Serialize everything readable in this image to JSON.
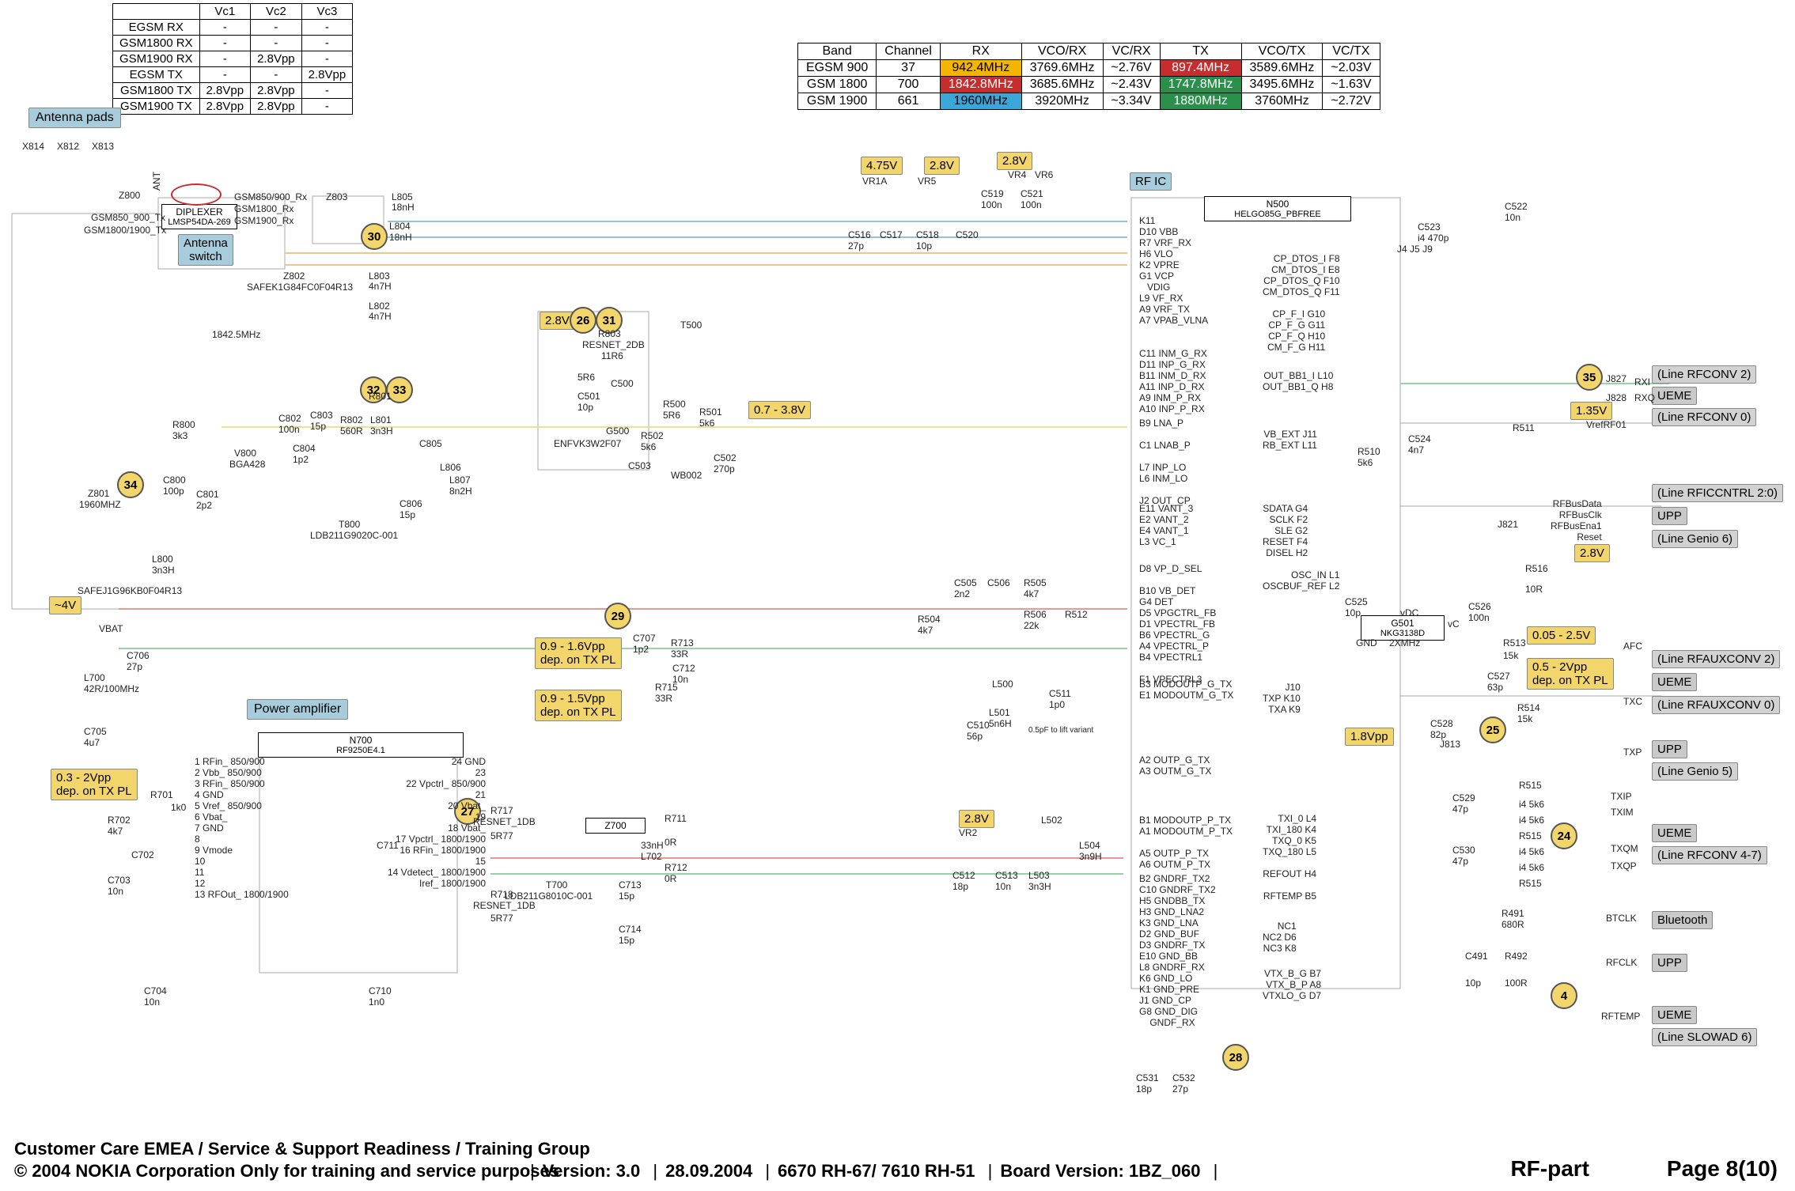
{
  "vc_table": {
    "headers": [
      "",
      "Vc1",
      "Vc2",
      "Vc3"
    ],
    "rows": [
      [
        "EGSM RX",
        "-",
        "-",
        "-"
      ],
      [
        "GSM1800 RX",
        "-",
        "-",
        "-"
      ],
      [
        "GSM1900 RX",
        "-",
        "2.8Vpp",
        "-"
      ],
      [
        "EGSM TX",
        "-",
        "-",
        "2.8Vpp"
      ],
      [
        "GSM1800 TX",
        "2.8Vpp",
        "2.8Vpp",
        "-"
      ],
      [
        "GSM1900 TX",
        "2.8Vpp",
        "2.8Vpp",
        "-"
      ]
    ]
  },
  "band_table": {
    "headers": [
      "Band",
      "Channel",
      "RX",
      "VCO/RX",
      "VC/RX",
      "TX",
      "VCO/TX",
      "VC/TX"
    ],
    "rows": [
      {
        "cells": [
          "EGSM 900",
          "37",
          "942.4MHz",
          "3769.6MHz",
          "~2.76V",
          "897.4MHz",
          "3589.6MHz",
          "~2.03V"
        ],
        "classes": [
          "",
          "",
          "c-yel",
          "",
          "",
          "c-red2",
          "",
          ""
        ]
      },
      {
        "cells": [
          "GSM 1800",
          "700",
          "1842.8MHz",
          "3685.6MHz",
          "~2.43V",
          "1747.8MHz",
          "3495.6MHz",
          "~1.63V"
        ],
        "classes": [
          "",
          "",
          "c-red2",
          "",
          "",
          "c-grn",
          "",
          ""
        ]
      },
      {
        "cells": [
          "GSM 1900",
          "661",
          "1960MHz",
          "3920MHz",
          "~3.34V",
          "1880MHz",
          "3760MHz",
          "~2.72V"
        ],
        "classes": [
          "",
          "",
          "c-blu",
          "",
          "",
          "c-grn",
          "",
          ""
        ]
      }
    ]
  },
  "tags": {
    "antenna_pads": "Antenna pads",
    "antenna_switch": "Antenna\nswitch",
    "power_amp": "Power amplifier",
    "rfic": "RF IC",
    "approx4v": "~4V",
    "v475": "4.75V",
    "v28a": "2.8V",
    "v28b": "2.8V",
    "v28c": "2.8V",
    "v28d": "2.8V",
    "v28e": "2.8V",
    "v135": "1.35V",
    "v18pp": "1.8Vpp",
    "v03_2": "0.3 - 2Vpp\ndep. on TX PL",
    "v09_16": "0.9 - 1.6Vpp\ndep. on TX PL",
    "v09_15": "0.9 - 1.5Vpp\ndep. on TX PL",
    "v07_38": "0.7 - 3.8V",
    "v005_25": "0.05 - 2.5V",
    "v05_2": "0.5 - 2Vpp\ndep. on TX PL",
    "line_rfconv2": "(Line RFCONV 2)",
    "line_rfconv0": "(Line RFCONV 0)",
    "line_rficntrl": "(Line RFICCNTRL 2:0)",
    "line_genio6": "(Line Genio 6)",
    "line_rfauxconv2": "(Line RFAUXCONV 2)",
    "line_rfauxconv0": "(Line RFAUXCONV 0)",
    "line_genio5": "(Line Genio 5)",
    "line_rfconv47": "(Line RFCONV 4-7)",
    "line_slowad6": "(Line SLOWAD 6)",
    "ueme1": "UEME",
    "ueme2": "UEME",
    "ueme3": "UEME",
    "ueme4": "UEME",
    "upp1": "UPP",
    "upp2": "UPP",
    "upp3": "UPP",
    "bluetooth": "Bluetooth"
  },
  "nodes": {
    "n30": "30",
    "n26": "26",
    "n31": "31",
    "n32": "32",
    "n33": "33",
    "n34": "34",
    "n29": "29",
    "n27": "27",
    "n35": "35",
    "n25": "25",
    "n24": "24",
    "n4": "4",
    "n28": "28"
  },
  "parts": {
    "x814": "X814",
    "x812": "X812",
    "x813": "X813",
    "z800": "Z800",
    "ant": "ANT",
    "diplexer": "DIPLEXER",
    "diplexer_p": "LMSP54DA-269",
    "gsm850_900_rx": "GSM850/900_Rx",
    "gsm1800_rx": "GSM1800_Rx",
    "gsm1900_rx": "GSM1900_Rx",
    "gsm850_900_tx": "GSM850_900_Tx",
    "gsm1800_1900_tx": "GSM1800/1900_Tx",
    "z803": "Z803",
    "l805": "L805",
    "l805v": "18nH",
    "l804": "L804",
    "l804v": "18nH",
    "z802": "Z802",
    "z802p": "SAFEK1G84FC0F04R13",
    "l803": "L803",
    "l803v": "4n7H",
    "l802": "L802",
    "l802v": "4n7H",
    "z801": "Z801",
    "z801hz": "1960MHZ",
    "l800": "L800",
    "l800v": "3n3H",
    "safej": "SAFEJ1G96KB0F04R13",
    "r800": "R800",
    "r800v": "3k3",
    "v800": "V800",
    "v800p": "BGA428",
    "c800": "C800",
    "c800v": "100p",
    "c801": "C801",
    "c801v": "2p2",
    "c802": "C802",
    "c802v": "100n",
    "c803": "C803",
    "c803v": "15p",
    "c804": "C804",
    "c804v": "1p2",
    "c805": "C805",
    "r801": "R801",
    "r802": "R802",
    "r802v": "560R",
    "l801": "L801",
    "l801v": "3n3H",
    "l806": "L806",
    "l807": "L807",
    "l807v": "8n2H",
    "c806": "C806",
    "c806v": "15p",
    "t800": "T800",
    "t800p": "LDB211G9020C-001",
    "r803": "R803",
    "r803p": "RESNET_2DB",
    "r803b": "11R6",
    "r803c": "5R6",
    "t500": "T500",
    "r500": "R500",
    "r500v": "5R6",
    "c500": "C500",
    "c501": "C501",
    "c501v": "10p",
    "r501": "R501",
    "r501v": "5k6",
    "r502": "R502",
    "r502v": "5k6",
    "c503": "C503",
    "g500": "G500",
    "envfvk": "ENFVK3W2F07",
    "wb002": "WB002",
    "c502": "C502",
    "c502v": "270p",
    "vr1a": "VR1A",
    "vr5": "VR5",
    "vr4": "VR4",
    "vr6": "VR6",
    "c516": "C516",
    "c516v": "27p",
    "c517": "C517",
    "c518": "C518",
    "c518v": "10p",
    "c519": "C519",
    "c519v": "100n",
    "c520": "C520",
    "c521": "C521",
    "c521v": "100n",
    "n500": "N500",
    "helgo": "HELGO85G_PBFREE",
    "n500_l": [
      "D10",
      "VBB",
      "R7",
      "VRF_RX",
      "H6",
      "VLO",
      "K2",
      "VPRE",
      "G1",
      "VCP",
      "VDIG",
      "L9",
      "VF_RX",
      "A9",
      "VRF_TX",
      "A7",
      "VPAB_VLNA"
    ],
    "c522": "C522",
    "c522v": "10n",
    "c523": "C523",
    "c523v": "i4 470p",
    "c524": "C524",
    "c524v": "4n7",
    "r510": "R510",
    "r510v": "5k6",
    "r511": "R511",
    "j827": "J827",
    "j828": "J828",
    "j821": "J821",
    "inm_g_rx": "INM_G_RX",
    "inp_g_rx": "INP_G_RX",
    "inm_d_rx": "INM_D_RX",
    "inp_d_rx": "INP_D_RX",
    "inm_p_rx": "INM_P_RX",
    "inp_p_rx": "INP_P_RX",
    "c11": "C11",
    "d11": "D11",
    "b11": "B11",
    "a11": "A11",
    "a9": "A9",
    "a10": "A10",
    "b9": "B9",
    "c1g": "C1",
    "l7": "L7",
    "l6": "L6",
    "j2": "J2",
    "lna_p": "LNA_P",
    "lnab_p": "LNAB_P",
    "inp_lo": "INP_LO",
    "inm_lo": "INM_LO",
    "out_cp": "OUT_CP",
    "e11": "E11",
    "e2": "E2",
    "e4": "E4",
    "l3": "L3",
    "vant3": "VANT_3",
    "vant2": "VANT_2",
    "vant1": "VANT_1",
    "vc1": "VC_1",
    "d8": "D8",
    "vp_d_sel": "VP_D_SEL",
    "b10g": "B10",
    "g4l": "G4",
    "d5": "D5",
    "d1": "D1",
    "b6": "B6",
    "a4": "A4",
    "b4": "B4",
    "vb_det": "VB_DET",
    "det": "DET",
    "vpgctrl_fb": "VPGCTRL_FB",
    "vpectrl_fb": "VPECTRL_FB",
    "vpectrl_g": "VPECTRL_G",
    "vpectrl_p": "VPECTRL_P",
    "vpectrl1": "VPECTRL1",
    "f1": "F1",
    "vpectrl3": "VPECTRL3",
    "c505": "C505",
    "c505v": "2n2",
    "c506": "C506",
    "r505": "R505",
    "r505v": "4k7",
    "r506": "R506",
    "r506v": "22k",
    "r504": "R504",
    "r504v": "4k7",
    "r512": "R512",
    "c707": "C707",
    "c707v": "1p2",
    "r713": "R713",
    "r713v": "33R",
    "r715": "R715",
    "r715v": "33R",
    "c712": "C712",
    "c712v": "10n",
    "l500": "L500",
    "l501": "L501",
    "l501v": "5n6H",
    "c510": "C510",
    "c510v": "56p",
    "c511": "C511",
    "c511v": "1p0",
    "l500t": "0.5pF to lift variant",
    "b3": "B3",
    "e1": "E1",
    "modoutp_g_tx": "MODOUTP_G_TX",
    "modoutm_g_tx": "MODOUTM_G_TX",
    "a2": "A2",
    "a3": "A3",
    "outp_g_tx": "OUTP_G_TX",
    "outm_g_tx": "OUTM_G_TX",
    "vr2": "VR2",
    "c512": "C512",
    "c512v": "18p",
    "c513": "C513",
    "c513v": "10n",
    "l502": "L502",
    "l503": "L503",
    "l503v": "3n3H",
    "l504": "L504",
    "l504v": "3n9H",
    "b1": "B1",
    "a1": "A1",
    "a5": "A5",
    "a6": "A6",
    "modoutp_p_tx": "MODOUTP_P_TX",
    "modoutm_p_tx": "MODOUTM_P_TX",
    "outp_p_tx": "OUTP_P_TX",
    "outm_p_tx": "OUTM_P_TX",
    "b2": "B2",
    "c10": "C10",
    "h5": "H5",
    "h3": "H3",
    "k3": "K3",
    "d2": "D2",
    "d3": "D3",
    "e10": "E10",
    "l8": "L8",
    "k6": "K6",
    "k1": "K1",
    "j1": "J1",
    "g8": "G8",
    "gndrf_tx2": "GNDRF_TX2",
    "gndbb_tx": "GNDBB_TX",
    "gnd_lna2": "GND_LNA2",
    "gnd_lna": "GND_LNA",
    "gnd_buf": "GND_BUF",
    "gndrf_tx": "GNDRF_TX",
    "gnd_bb": "GND_BB",
    "gndrf_rx": "GNDRF_RX",
    "gnd_lo": "GND_LO",
    "gnd_pre": "GND_PRE",
    "gnd_cp": "GND_CP",
    "gnd_dig": "GND_DIG",
    "gndf_rx": "GNDF_RX",
    "cp_f_i": "CP_F_I",
    "g10": "G10",
    "cp_f_g": "CP_F_G",
    "g11": "G11",
    "cp_f_q": "CP_F_Q",
    "h10": "H10",
    "cm_f_g": "CM_F_G",
    "h11": "H11",
    "cp_dtos_i": "CP_DTOS_I",
    "cm_dtos_i": "CM_DTOS_I",
    "cp_dtos_q": "CP_DTOS_Q",
    "cm_dtos_q": "CM_DTOS_Q",
    "f8": "F8",
    "e8": "E8",
    "f10": "F10",
    "f11": "F11",
    "j4": "J4",
    "j5": "J5",
    "j9": "J9",
    "out_bb1_i": "OUT_BB1_I",
    "out_bb1_q": "OUT_BB1_Q",
    "l10": "L10",
    "h8": "H8",
    "vb_ext": "VB_EXT",
    "rb_ext": "RB_EXT",
    "j11": "J11",
    "l11": "L11",
    "sdata": "SDATA",
    "sclk": "SCLK",
    "sle": "SLE",
    "reset": "RESET",
    "disel": "DISEL",
    "g4": "G4",
    "f2": "F2",
    "g2": "G2",
    "f4": "F4",
    "h2": "H2",
    "osc_in": "OSC_IN",
    "oscbuf_ref": "OSCBUF_REF",
    "l1": "L1",
    "l2": "L2",
    "rfbusdata": "RFBusData",
    "rfbusclk": "RFBusClk",
    "rfbusena1": "RFBusEna1",
    "resetpin": "Reset",
    "g501": "G501",
    "nkg": "NKG3138D",
    "vdc": "vDC",
    "vc": "vC",
    "c525": "C525",
    "c525v": "10p",
    "c526": "C526",
    "c526v": "100n",
    "c527": "C527",
    "c527v": "63p",
    "c528": "C528",
    "c528v": "82p",
    "r513": "R513",
    "r513v": "15k",
    "r514": "R514",
    "r514v": "15k",
    "r516": "R516",
    "r516v": "10R",
    "j10": "J10",
    "txp": "TXP",
    "txa": "TXA",
    "k10p": "K10",
    "k9": "K9",
    "afc": "AFC",
    "txc": "TXC",
    "txp2": "TXP",
    "gnd2": "GND",
    "xmhz": "2XMHz",
    "txi_0": "TXI_0",
    "txi_180": "TXI_180",
    "txq_0": "TXQ_0",
    "txq_180": "TXQ_180",
    "l4": "L4",
    "k4": "K4",
    "k5": "K5",
    "l5": "L5",
    "refout": "REFOUT",
    "h4": "H4",
    "rftemp": "RFTEMP",
    "b5": "B5",
    "nc1": "NC1",
    "nc2": "NC2",
    "nc3": "NC3",
    "d6": "D6",
    "k8": "K8",
    "vtx_b_g": "VTX_B_G",
    "vtx_b_p": "VTX_B_P",
    "vtxlo_g": "VTXLO_G",
    "b7": "B7",
    "a8": "A8",
    "d7": "D7",
    "c529": "C529",
    "c529v": "47p",
    "c530": "C530",
    "c530v": "47p",
    "r515": "R515",
    "r515v": "i4 5k6",
    "txip": "TXIP",
    "txim": "TXIM",
    "txqp": "TXQP",
    "txqm": "TXQM",
    "txqm2": "TXQM",
    "txqp2": "TXQP",
    "r491": "R491",
    "r491v": "680R",
    "btclk": "BTCLK",
    "c491": "C491",
    "c491v": "10p",
    "r492": "R492",
    "r492v": "100R",
    "rfclk": "RFCLK",
    "rftemp2": "RFTEMP",
    "c531": "C531",
    "c531v": "18p",
    "c532": "C532",
    "c532v": "27p",
    "j813": "J813",
    "vbat": "VBAT",
    "c706": "C706",
    "c706v": "27p",
    "l700": "L700",
    "l700v": "42R/100MHz",
    "c705": "C705",
    "c705v": "4u7",
    "c702": "C702",
    "c703": "C703",
    "c703v": "10n",
    "r701": "R701",
    "r702": "R702",
    "r702v": "4k7",
    "n700": "N700",
    "n700p": "RF9250E4.1",
    "n700_left": [
      "1  RFin_ 850/900",
      "2  Vbb_ 850/900",
      "3  RFin_ 850/900",
      "4  GND",
      "5  Vref_ 850/900",
      "6  Vbat_",
      "7  GND",
      "8",
      "9  Vmode",
      "10",
      "11",
      "12",
      "13  RFOut_ 1800/1900"
    ],
    "n700_right": [
      "24  GND",
      "23",
      "22  Vpctrl_ 850/900",
      "21",
      "20  Vbat_",
      "19",
      "18  Vbat_",
      "17  Vpctrl_ 1800/1900",
      "16  RFin_ 1800/1900",
      "15",
      "14  Vdetect_ 1800/1900",
      "Iref_ 1800/1900"
    ],
    "r717": "R717",
    "r717p": "RESNET_1DB",
    "r717v": "5R77",
    "r718": "R718",
    "r718p": "RESNET_1DB",
    "r718v": "5R77",
    "z700": "Z700",
    "r711": "R711",
    "r711v": "0R",
    "r712": "R712",
    "r712v": "0R",
    "l702": "L702",
    "l702v": "33nH",
    "t700": "T700",
    "t700p": "LDB211G8010C-001",
    "c713": "C713",
    "c713v": "15p",
    "c714": "C714",
    "c714v": "15p",
    "c710": "C710",
    "c710v": "1n0",
    "c704": "C704",
    "c704v": "10n",
    "c711": "C711",
    "k11": "K11",
    "vref_rf01": "VrefRF01",
    "rxi": "RXI",
    "rxq": "RXQ",
    "1842": "1842.5MHz",
    "1k0": "1k0"
  },
  "footer": {
    "line1": "Customer Care EMEA / Service & Support Readiness / Training Group",
    "line2": "© 2004 NOKIA Corporation  Only for training and service purposes",
    "version": "Version: 3.0",
    "date": "28.09.2004",
    "product": "6670 RH-67/ 7610 RH-51",
    "board": "Board Version: 1BZ_060",
    "section": "RF-part",
    "page": "Page 8(10)"
  }
}
